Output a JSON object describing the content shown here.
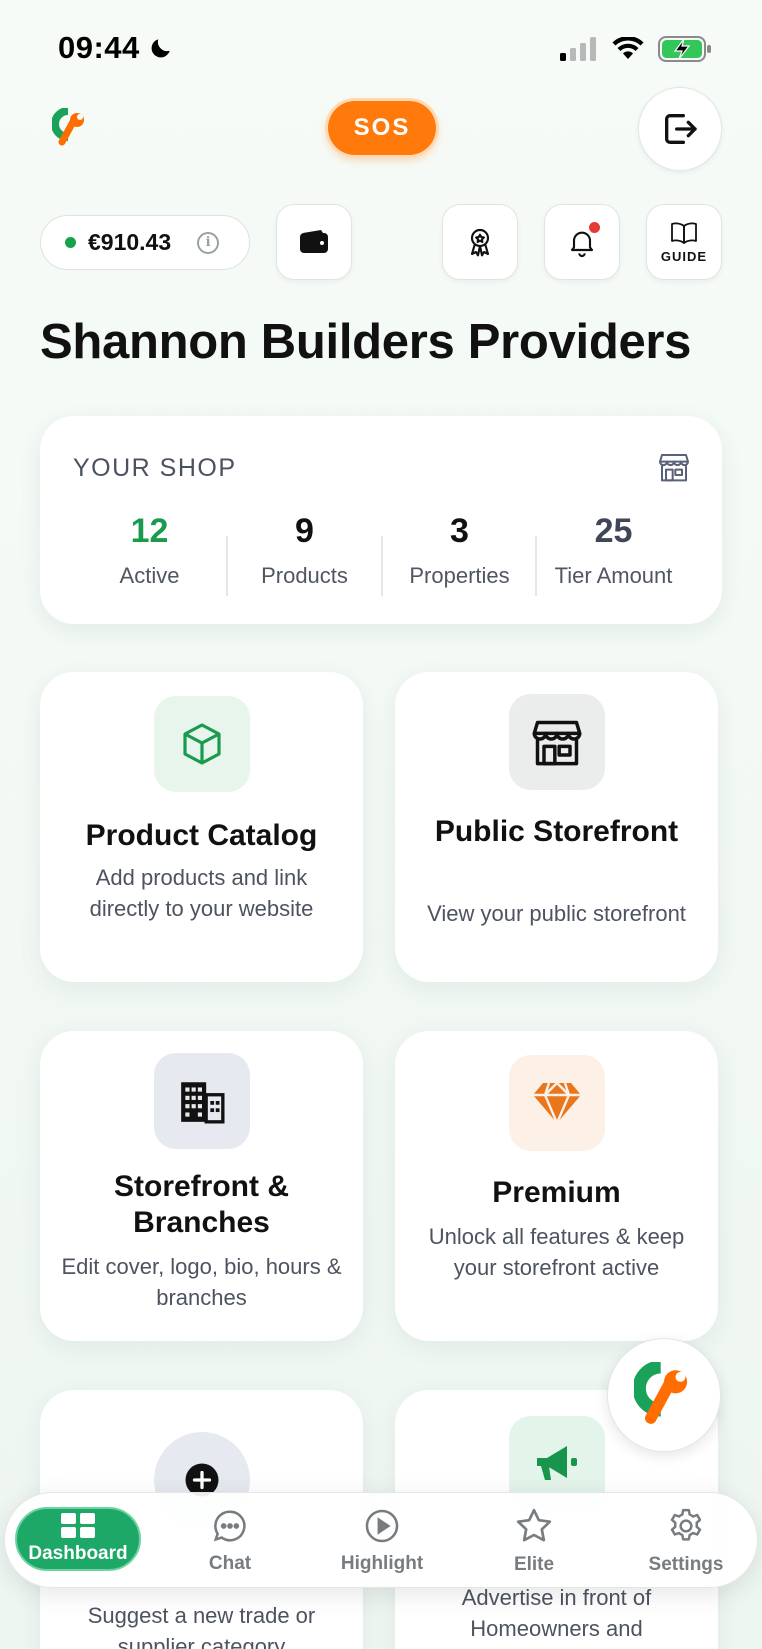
{
  "status_bar": {
    "time": "09:44"
  },
  "header": {
    "sos_label": "SOS",
    "balance": "€910.43",
    "guide_label": "GUIDE"
  },
  "page": {
    "title": "Shannon Builders Providers"
  },
  "shop": {
    "label": "YOUR SHOP",
    "stats": [
      {
        "value": "12",
        "label": "Active",
        "color": "#1a9a4c"
      },
      {
        "value": "9",
        "label": "Products",
        "color": "#111111"
      },
      {
        "value": "3",
        "label": "Properties",
        "color": "#111111"
      },
      {
        "value": "25",
        "label": "Tier Amount",
        "color": "#3f4658"
      }
    ]
  },
  "tiles": [
    {
      "title": "Product Catalog",
      "desc": "Add products and link directly to your website",
      "icon": "cube-icon"
    },
    {
      "title": "Public Storefront",
      "desc": "View your public storefront",
      "icon": "store-icon"
    },
    {
      "title": "Storefront & Branches",
      "desc": "Edit cover, logo, bio, hours & branches",
      "icon": "buildings-icon"
    },
    {
      "title": "Premium",
      "desc": "Unlock all features & keep your storefront active",
      "icon": "diamond-icon"
    },
    {
      "title": "",
      "desc": "Suggest a new trade or supplier category",
      "icon": "plus-circle-icon"
    },
    {
      "title": "",
      "desc": "Advertise in front of Homeowners and",
      "icon": "megaphone-icon"
    }
  ],
  "nav": {
    "items": [
      {
        "label": "Dashboard",
        "icon": "grid-icon"
      },
      {
        "label": "Chat",
        "icon": "chat-bubble-icon"
      },
      {
        "label": "Highlight",
        "icon": "play-circle-icon"
      },
      {
        "label": "Elite",
        "icon": "star-icon"
      },
      {
        "label": "Settings",
        "icon": "gear-icon"
      }
    ]
  },
  "colors": {
    "accent": "#1ea868",
    "sos": "#ff7a0a",
    "notification_dot": "#e53935"
  }
}
